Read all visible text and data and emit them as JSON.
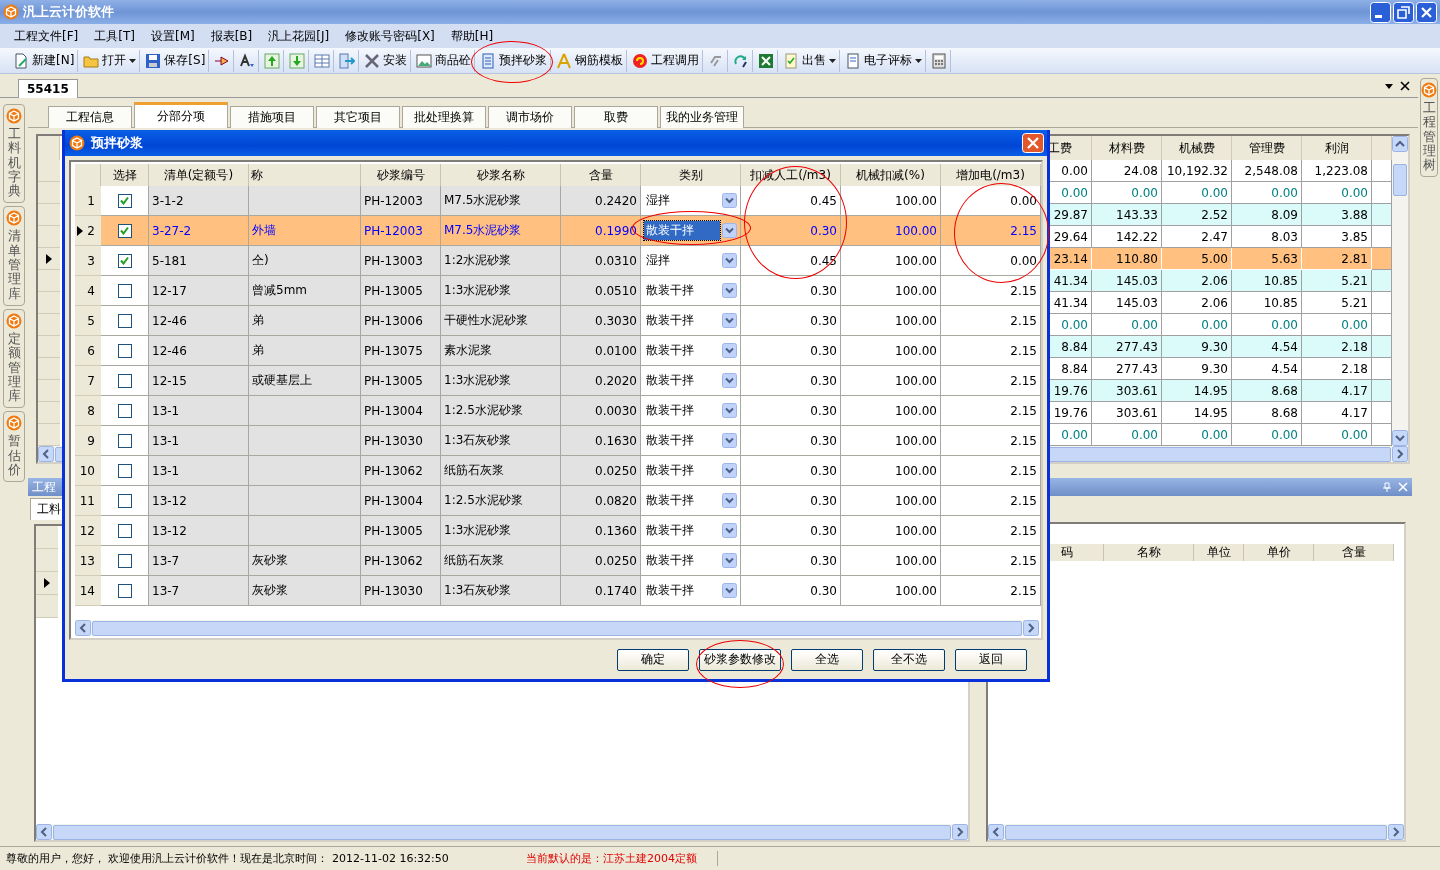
{
  "window": {
    "title": "汎上云计价软件"
  },
  "menu": [
    "工程文件[F]",
    "工具[T]",
    "设置[M]",
    "报表[B]",
    "汎上花园[J]",
    "修改账号密码[X]",
    "帮助[H]"
  ],
  "toolbar": [
    {
      "kind": "button",
      "label": "新建[N]",
      "circled": false
    },
    {
      "kind": "dropdown",
      "label": "打开",
      "circled": false
    },
    {
      "kind": "button",
      "label": "保存[S]",
      "circled": false
    },
    {
      "kind": "icon",
      "circled": false
    },
    {
      "kind": "icon",
      "circled": false
    },
    {
      "kind": "icon",
      "circled": false
    },
    {
      "kind": "icon",
      "circled": false
    },
    {
      "kind": "icon",
      "circled": false
    },
    {
      "kind": "icon",
      "circled": false
    },
    {
      "kind": "button",
      "label": "安装",
      "circled": false
    },
    {
      "kind": "button",
      "label": "商品砼",
      "circled": false
    },
    {
      "kind": "button",
      "label": "预拌砂浆",
      "circled": true
    },
    {
      "kind": "button",
      "label": "钢筋模板",
      "circled": false
    },
    {
      "kind": "button",
      "label": "工程调用",
      "circled": false
    },
    {
      "kind": "icon",
      "circled": false
    },
    {
      "kind": "icon",
      "circled": false
    },
    {
      "kind": "icon",
      "circled": false
    },
    {
      "kind": "dropdown",
      "label": "出售",
      "circled": false
    },
    {
      "kind": "dropdown",
      "label": "电子评标",
      "circled": false
    },
    {
      "kind": "icon",
      "circled": false
    }
  ],
  "document_tab": "55415",
  "left_sidebar": [
    {
      "label": "工料机字典"
    },
    {
      "label": "清单管理库"
    },
    {
      "label": "定额管理库"
    },
    {
      "label": "暂估价"
    }
  ],
  "right_sidebar": [
    {
      "label": "工程管理树"
    }
  ],
  "tabs": [
    {
      "label": "工程信息",
      "selected": false
    },
    {
      "label": "分部分项",
      "selected": true
    },
    {
      "label": "措施项目",
      "selected": false
    },
    {
      "label": "其它项目",
      "selected": false
    },
    {
      "label": "批处理换算",
      "selected": false
    },
    {
      "label": "调市场价",
      "selected": false
    },
    {
      "label": "取费",
      "selected": false
    },
    {
      "label": "我的业务管理",
      "selected": false
    }
  ],
  "upper_grid": {
    "columns": [
      "工费",
      "材料费",
      "机械费",
      "管理费",
      "利润"
    ],
    "rows": [
      {
        "kind": "total",
        "shaded": false,
        "selected": false,
        "cells": [
          "0.00",
          "24.08",
          "10,192.32",
          "2,548.08",
          "1,223.08"
        ]
      },
      {
        "kind": "group",
        "shaded": false,
        "selected": false,
        "cells": [
          "0.00",
          "0.00",
          "0.00",
          "0.00",
          "0.00"
        ]
      },
      {
        "kind": "item",
        "shaded": true,
        "selected": false,
        "cells": [
          "29.87",
          "143.33",
          "2.52",
          "8.09",
          "3.88"
        ]
      },
      {
        "kind": "item",
        "shaded": false,
        "selected": false,
        "cells": [
          "29.64",
          "142.22",
          "2.47",
          "8.03",
          "3.85"
        ]
      },
      {
        "kind": "item",
        "shaded": false,
        "selected": true,
        "cells": [
          "23.14",
          "110.80",
          "5.00",
          "5.63",
          "2.81"
        ]
      },
      {
        "kind": "item",
        "shaded": true,
        "selected": false,
        "cells": [
          "41.34",
          "145.03",
          "2.06",
          "10.85",
          "5.21"
        ]
      },
      {
        "kind": "item",
        "shaded": false,
        "selected": false,
        "cells": [
          "41.34",
          "145.03",
          "2.06",
          "10.85",
          "5.21"
        ]
      },
      {
        "kind": "group",
        "shaded": false,
        "selected": false,
        "cells": [
          "0.00",
          "0.00",
          "0.00",
          "0.00",
          "0.00"
        ]
      },
      {
        "kind": "item",
        "shaded": true,
        "selected": false,
        "cells": [
          "8.84",
          "277.43",
          "9.30",
          "4.54",
          "2.18"
        ]
      },
      {
        "kind": "item",
        "shaded": false,
        "selected": false,
        "cells": [
          "8.84",
          "277.43",
          "9.30",
          "4.54",
          "2.18"
        ]
      },
      {
        "kind": "item",
        "shaded": true,
        "selected": false,
        "cells": [
          "19.76",
          "303.61",
          "14.95",
          "8.68",
          "4.17"
        ]
      },
      {
        "kind": "item",
        "shaded": false,
        "selected": false,
        "cells": [
          "19.76",
          "303.61",
          "14.95",
          "8.68",
          "4.17"
        ]
      },
      {
        "kind": "group",
        "shaded": false,
        "selected": false,
        "cells": [
          "0.00",
          "0.00",
          "0.00",
          "0.00",
          "0.00"
        ]
      }
    ]
  },
  "lower_left": {
    "title": "工程",
    "tab": "工料"
  },
  "lower_right": {
    "columns": [
      "码",
      "名称",
      "单位",
      "单价",
      "含量"
    ]
  },
  "dialog": {
    "title": "预拌砂浆",
    "columns": [
      {
        "label": "选择",
        "circled": false
      },
      {
        "label": "清单(定额号)",
        "circled": false
      },
      {
        "label": "称",
        "circled": false
      },
      {
        "label": "砂浆编号",
        "circled": false
      },
      {
        "label": "砂浆名称",
        "circled": false
      },
      {
        "label": "含量",
        "circled": false
      },
      {
        "label": "类别",
        "circled": false
      },
      {
        "label": "扣减人工(/m3)",
        "circled": true
      },
      {
        "label": "机械扣减(%)",
        "circled": false
      },
      {
        "label": "增加电(/m3)",
        "circled": true
      }
    ],
    "rows": [
      {
        "num": "1",
        "checked": true,
        "selected": false,
        "code": "3-1-2",
        "mortar_code": "PH-12003",
        "mortar_name": "M7.5水泥砂浆",
        "amount": "0.2420",
        "type": "湿拌",
        "type_circled": false,
        "labor": "0.45",
        "machine": "100.00",
        "power": "0.00"
      },
      {
        "num": "2",
        "checked": true,
        "selected": true,
        "code": "3-27-2",
        "name": "外墙",
        "mortar_code": "PH-12003",
        "mortar_name": "M7.5水泥砂浆",
        "amount": "0.1990",
        "type": "散装干拌",
        "type_circled": true,
        "labor": "0.30",
        "machine": "100.00",
        "power": "2.15"
      },
      {
        "num": "3",
        "checked": true,
        "selected": false,
        "code": "5-181",
        "name": "仝)",
        "mortar_code": "PH-13003",
        "mortar_name": "1:2水泥砂浆",
        "amount": "0.0310",
        "type": "湿拌",
        "type_circled": false,
        "labor": "0.45",
        "machine": "100.00",
        "power": "0.00"
      },
      {
        "num": "4",
        "checked": false,
        "selected": false,
        "code": "12-17",
        "name": "曾减5mm",
        "mortar_code": "PH-13005",
        "mortar_name": "1:3水泥砂浆",
        "amount": "0.0510",
        "type": "散装干拌",
        "type_circled": false,
        "labor": "0.30",
        "machine": "100.00",
        "power": "2.15"
      },
      {
        "num": "5",
        "checked": false,
        "selected": false,
        "code": "12-46",
        "name": "弟",
        "mortar_code": "PH-13006",
        "mortar_name": "干硬性水泥砂浆",
        "amount": "0.3030",
        "type": "散装干拌",
        "type_circled": false,
        "labor": "0.30",
        "machine": "100.00",
        "power": "2.15"
      },
      {
        "num": "6",
        "checked": false,
        "selected": false,
        "code": "12-46",
        "name": "弟",
        "mortar_code": "PH-13075",
        "mortar_name": "素水泥浆",
        "amount": "0.0100",
        "type": "散装干拌",
        "type_circled": false,
        "labor": "0.30",
        "machine": "100.00",
        "power": "2.15"
      },
      {
        "num": "7",
        "checked": false,
        "selected": false,
        "code": "12-15",
        "name": "或硬基层上",
        "mortar_code": "PH-13005",
        "mortar_name": "1:3水泥砂浆",
        "amount": "0.2020",
        "type": "散装干拌",
        "type_circled": false,
        "labor": "0.30",
        "machine": "100.00",
        "power": "2.15"
      },
      {
        "num": "8",
        "checked": false,
        "selected": false,
        "code": "13-1",
        "mortar_code": "PH-13004",
        "mortar_name": "1:2.5水泥砂浆",
        "amount": "0.0030",
        "type": "散装干拌",
        "type_circled": false,
        "labor": "0.30",
        "machine": "100.00",
        "power": "2.15"
      },
      {
        "num": "9",
        "checked": false,
        "selected": false,
        "code": "13-1",
        "mortar_code": "PH-13030",
        "mortar_name": "1:3石灰砂浆",
        "amount": "0.1630",
        "type": "散装干拌",
        "type_circled": false,
        "labor": "0.30",
        "machine": "100.00",
        "power": "2.15"
      },
      {
        "num": "10",
        "checked": false,
        "selected": false,
        "code": "13-1",
        "mortar_code": "PH-13062",
        "mortar_name": "纸筋石灰浆",
        "amount": "0.0250",
        "type": "散装干拌",
        "type_circled": false,
        "labor": "0.30",
        "machine": "100.00",
        "power": "2.15"
      },
      {
        "num": "11",
        "checked": false,
        "selected": false,
        "code": "13-12",
        "mortar_code": "PH-13004",
        "mortar_name": "1:2.5水泥砂浆",
        "amount": "0.0820",
        "type": "散装干拌",
        "type_circled": false,
        "labor": "0.30",
        "machine": "100.00",
        "power": "2.15"
      },
      {
        "num": "12",
        "checked": false,
        "selected": false,
        "code": "13-12",
        "mortar_code": "PH-13005",
        "mortar_name": "1:3水泥砂浆",
        "amount": "0.1360",
        "type": "散装干拌",
        "type_circled": false,
        "labor": "0.30",
        "machine": "100.00",
        "power": "2.15"
      },
      {
        "num": "13",
        "checked": false,
        "selected": false,
        "code": "13-7",
        "name": "灰砂浆",
        "mortar_code": "PH-13062",
        "mortar_name": "纸筋石灰浆",
        "amount": "0.0250",
        "type": "散装干拌",
        "type_circled": false,
        "labor": "0.30",
        "machine": "100.00",
        "power": "2.15"
      },
      {
        "num": "14",
        "checked": false,
        "selected": false,
        "code": "13-7",
        "name": "灰砂浆",
        "mortar_code": "PH-13030",
        "mortar_name": "1:3石灰砂浆",
        "amount": "0.1740",
        "type": "散装干拌",
        "type_circled": false,
        "labor": "0.30",
        "machine": "100.00",
        "power": "2.15"
      }
    ],
    "buttons": [
      {
        "label": "确定",
        "circled": false
      },
      {
        "label": "砂浆参数修改",
        "circled": true
      },
      {
        "label": "全选",
        "circled": false
      },
      {
        "label": "全不选",
        "circled": false
      },
      {
        "label": "返回",
        "circled": false
      }
    ]
  },
  "status_bar": {
    "message": "尊敬的用户，您好， 欢迎使用汎上云计价软件！现在是北京时间： 2012-11-02 16:32:50",
    "notice": "当前默认的是：江苏土建2004定额"
  }
}
